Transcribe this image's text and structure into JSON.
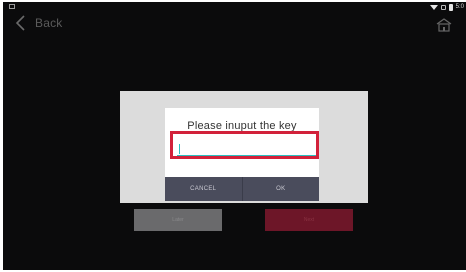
{
  "statusbar": {
    "time": "5:0"
  },
  "nav": {
    "back_label": "Back"
  },
  "dialog": {
    "title": "Please inuput the key",
    "input_value": "",
    "cancel_label": "CANCEL",
    "ok_label": "OK"
  },
  "background_buttons": {
    "left_label": "Later",
    "right_label": "Next"
  },
  "colors": {
    "highlight": "#d2213a",
    "input_underline": "#2bbfc0",
    "dialog_button_bg": "#4a4c5c"
  },
  "icons": [
    "back-chevron-icon",
    "home-icon",
    "wifi-icon",
    "signal-icon",
    "battery-icon"
  ]
}
